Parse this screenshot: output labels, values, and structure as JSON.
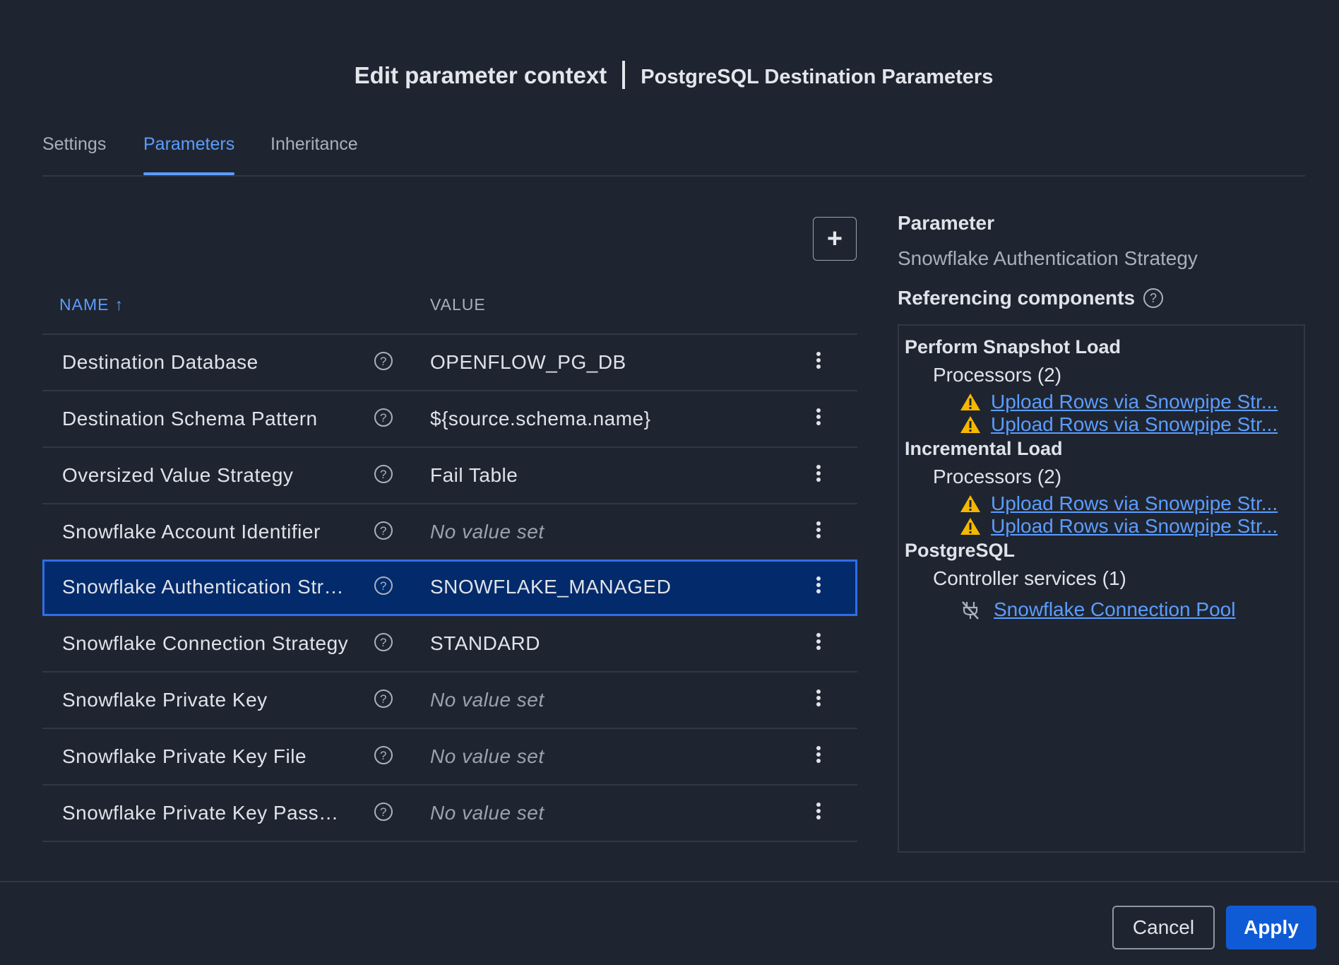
{
  "dialog": {
    "title": "Edit parameter context",
    "context_name": "PostgreSQL Destination Parameters"
  },
  "tabs": [
    {
      "label": "Settings",
      "active": false
    },
    {
      "label": "Parameters",
      "active": true
    },
    {
      "label": "Inheritance",
      "active": false
    }
  ],
  "add_button": {
    "icon": "plus-icon",
    "label": "+"
  },
  "table": {
    "columns": {
      "name": "NAME",
      "value": "VALUE"
    },
    "sort": {
      "column": "name",
      "direction": "ascending",
      "icon": "arrow-up-icon",
      "glyph": "↑"
    },
    "rows": [
      {
        "name": "Destination Database",
        "value": "OPENFLOW_PG_DB",
        "empty": false
      },
      {
        "name": "Destination Schema Pattern",
        "value": "${source.schema.name}",
        "empty": false
      },
      {
        "name": "Oversized Value Strategy",
        "value": "Fail Table",
        "empty": false
      },
      {
        "name": "Snowflake Account Identifier",
        "value": "No value set",
        "empty": true
      },
      {
        "name": "Snowflake Authentication Strategy",
        "display": "Snowflake Authentication Stra...",
        "value": "SNOWFLAKE_MANAGED",
        "empty": false,
        "selected": true
      },
      {
        "name": "Snowflake Connection Strategy",
        "value": "STANDARD",
        "empty": false
      },
      {
        "name": "Snowflake Private Key",
        "value": "No value set",
        "empty": true
      },
      {
        "name": "Snowflake Private Key File",
        "value": "No value set",
        "empty": true
      },
      {
        "name": "Snowflake Private Key Password",
        "display": "Snowflake Private Key Passwo...",
        "value": "No value set",
        "empty": true
      }
    ],
    "help_glyph": "?"
  },
  "side": {
    "parameter_heading": "Parameter",
    "parameter_name": "Snowflake Authentication Strategy",
    "referencing_heading": "Referencing components",
    "groups": [
      {
        "name": "Perform Snapshot Load",
        "category": "Processors (2)",
        "items": [
          "Upload Rows via Snowpipe Str...",
          "Upload Rows via Snowpipe Str..."
        ],
        "icon": "warning-icon"
      },
      {
        "name": "Incremental Load",
        "category": "Processors (2)",
        "items": [
          "Upload Rows via Snowpipe Str...",
          "Upload Rows via Snowpipe Str..."
        ],
        "icon": "warning-icon"
      },
      {
        "name": "PostgreSQL",
        "category": "Controller services (1)",
        "items": [
          "Snowflake Connection Pool"
        ],
        "icon": "disabled-service-icon"
      }
    ]
  },
  "footer": {
    "cancel_label": "Cancel",
    "apply_label": "Apply"
  },
  "colors": {
    "accent": "#5b9dff",
    "selected_row": "#032a6b",
    "apply": "#0f5bd6",
    "warning": "#f5b800"
  }
}
